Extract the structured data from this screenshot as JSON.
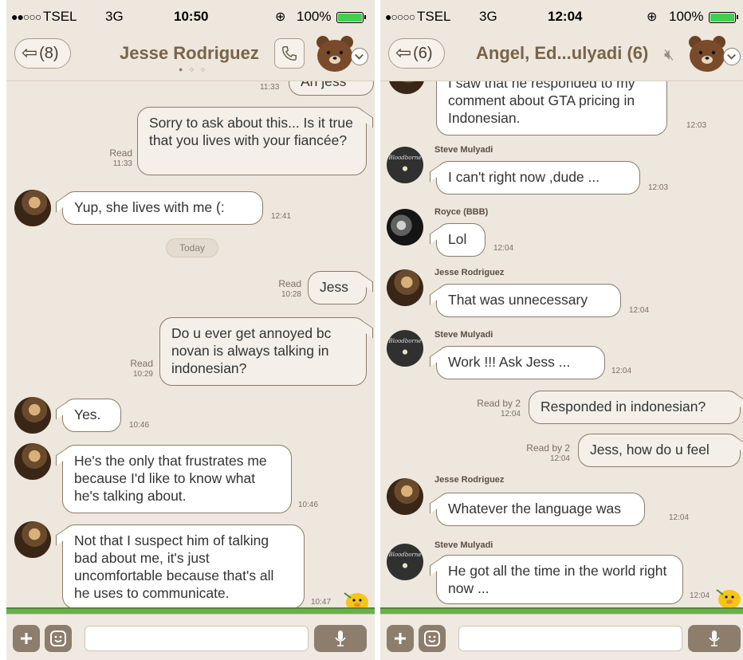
{
  "left": {
    "status": {
      "signal": "●●○○○",
      "carrier": "TSEL",
      "network": "3G",
      "time": "10:50",
      "lock": "⊕",
      "battery": "100%"
    },
    "header": {
      "back_count": "(8)",
      "title": "Jesse Rodriguez",
      "page_dots": "● ○ ○"
    },
    "top_partial": {
      "time": "11:33",
      "text": "Ah jess"
    },
    "msg1": {
      "text": "Sorry to ask about this... Is it true that you lives with your fiancée?",
      "read": "Read",
      "time": "11:33"
    },
    "msg2": {
      "text": "Yup, she lives with me (:",
      "time": "12:41"
    },
    "date_divider": "Today",
    "msg3": {
      "text": "Jess",
      "read": "Read",
      "time": "10:28"
    },
    "msg4": {
      "text": "Do u ever get annoyed bc novan is always talking in indonesian?",
      "read": "Read",
      "time": "10:29"
    },
    "msg5": {
      "text": "Yes.",
      "time": "10:46"
    },
    "msg6": {
      "text": "He's the only that frustrates me because I'd like to know what he's talking about.",
      "time": "10:46"
    },
    "msg7": {
      "text": "Not that I suspect him of talking bad about me, it's just uncomfortable because that's all he uses to communicate.",
      "time": "10:47"
    }
  },
  "right": {
    "status": {
      "signal": "●○○○○",
      "carrier": "TSEL",
      "network": "3G",
      "time": "12:04",
      "lock": "⊕",
      "battery": "100%"
    },
    "header": {
      "back_count": "(6)",
      "title": "Angel, Ed...ulyadi (6)"
    },
    "msg1": {
      "text": "I saw that he responded to my comment about GTA pricing in Indonesian.",
      "time": "12:03"
    },
    "msg2": {
      "sender": "Steve Mulyadi",
      "text": "I can't right now ,dude ...",
      "time": "12:03"
    },
    "msg3": {
      "sender": "Royce (BBB)",
      "text": "Lol",
      "time": "12:04"
    },
    "msg4": {
      "sender": "Jesse Rodriguez",
      "text": "That was unnecessary",
      "time": "12:04"
    },
    "msg5": {
      "sender": "Steve Mulyadi",
      "text": "Work !!! Ask Jess ...",
      "time": "12:04"
    },
    "msg6": {
      "text": "Responded in indonesian?",
      "read": "Read by 2",
      "time": "12:04"
    },
    "msg7": {
      "text": "Jess, how do u feel",
      "read": "Read by 2",
      "time": "12:04"
    },
    "msg8": {
      "sender": "Jesse Rodriguez",
      "text": "Whatever the language was",
      "time": "12:04"
    },
    "msg9": {
      "sender": "Steve Mulyadi",
      "text": "He got all the time in the world right now ...",
      "time": "12:04"
    },
    "avatar_label": "Bloodborne"
  },
  "icons": {
    "back": "back-arrow-icon",
    "call": "phone-icon",
    "mute": "mute-icon",
    "mascot": "brown-bear-icon",
    "dropdown": "chevron-down-icon",
    "plus": "plus-icon",
    "emoji": "emoji-icon",
    "mic": "microphone-icon",
    "sticker": "sally-chick-icon"
  },
  "colors": {
    "background": "#ede7dd",
    "title": "#7a6349",
    "outgoing_bubble": "#f4f0e9",
    "incoming_bubble": "#ffffff",
    "battery": "#3fd14e",
    "grass": "#6ab04c"
  }
}
